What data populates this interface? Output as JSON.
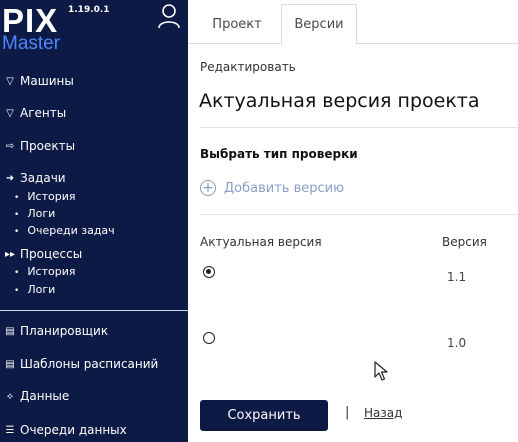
{
  "app": {
    "logo_main": "PIX",
    "logo_sub": "Master",
    "version": "1.19.0.1"
  },
  "sidebar": {
    "items": [
      {
        "label": "Машины",
        "icon": "filter-icon"
      },
      {
        "label": "Агенты",
        "icon": "filter-icon"
      },
      {
        "label": "Проекты",
        "icon": "arrow-outline-icon"
      },
      {
        "label": "Задачи",
        "icon": "arrow-solid-icon"
      },
      {
        "label": "Процессы",
        "icon": "fast-forward-icon"
      },
      {
        "label": "Планировщик",
        "icon": "calendar-icon"
      },
      {
        "label": "Шаблоны расписаний",
        "icon": "calendar-icon"
      },
      {
        "label": "Данные",
        "icon": "data-icon"
      },
      {
        "label": "Очереди данных",
        "icon": "list-icon"
      }
    ],
    "tasks_sub": [
      "История",
      "Логи",
      "Очереди задач"
    ],
    "process_sub": [
      "История",
      "Логи"
    ]
  },
  "tabs": {
    "project": "Проект",
    "versions": "Версии",
    "active": "versions"
  },
  "main": {
    "edit_label": "Редактировать",
    "title": "Актуальная версия проекта",
    "section_title": "Выбрать тип проверки",
    "add_version": "Добавить версию",
    "table": {
      "col_actual": "Актуальная версия",
      "col_version": "Версия",
      "rows": [
        {
          "selected": true,
          "version": "1.1"
        },
        {
          "selected": false,
          "version": "1.0"
        }
      ]
    },
    "save_label": "Сохранить",
    "separator": "|",
    "back_label": "Назад"
  },
  "colors": {
    "sidebar_bg": "#0c1a45",
    "logo_accent": "#4f86ff",
    "add_version": "#8a9fc4"
  }
}
